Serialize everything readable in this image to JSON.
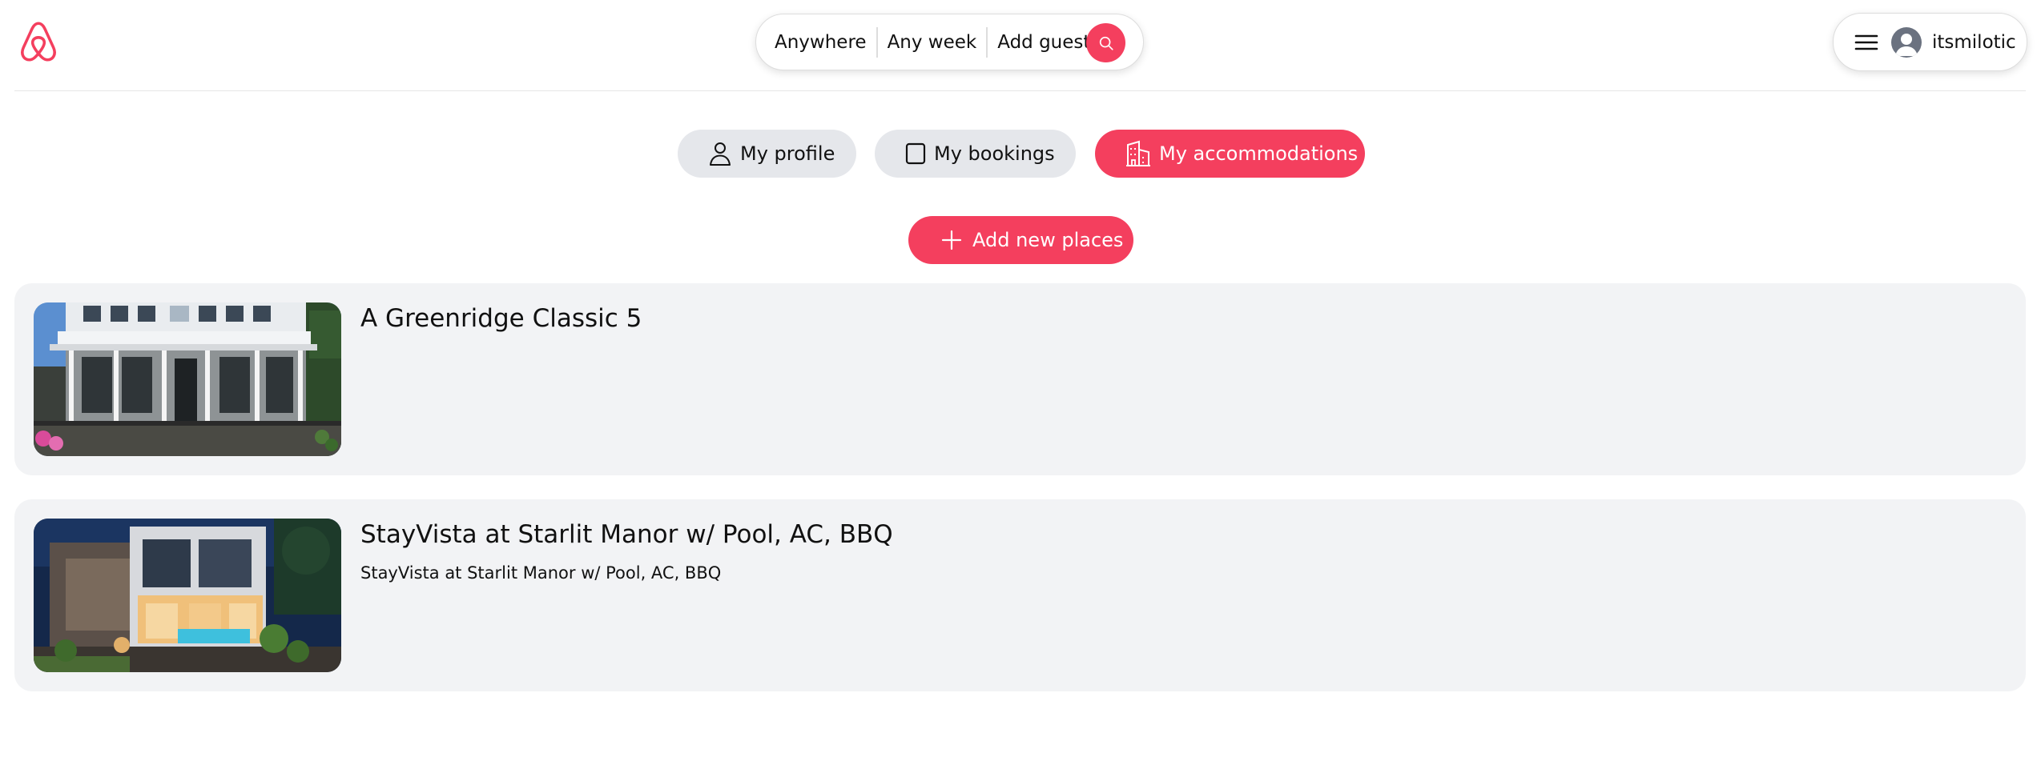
{
  "header": {
    "logo_icon": "airbnb-logo-icon",
    "search": {
      "where": "Anywhere",
      "when": "Any week",
      "guests": "Add guests",
      "button_icon": "search-icon"
    },
    "user_menu": {
      "menu_icon": "hamburger-icon",
      "avatar_icon": "user-avatar-icon",
      "username": "itsmilotic"
    }
  },
  "account_nav": {
    "tabs": [
      {
        "label": "My profile",
        "icon": "user-icon",
        "active": false
      },
      {
        "label": "My bookings",
        "icon": "bookings-icon",
        "active": false
      },
      {
        "label": "My accommodations",
        "icon": "buildings-icon",
        "active": true
      }
    ]
  },
  "add_button": {
    "label": "Add new places",
    "icon": "plus-icon"
  },
  "places": [
    {
      "title": "A Greenridge Classic 5",
      "description": ""
    },
    {
      "title": "StayVista at Starlit Manor w/ Pool, AC, BBQ",
      "description": "StayVista at Starlit Manor w/ Pool, AC, BBQ"
    }
  ],
  "colors": {
    "brand": "#f43f5e",
    "pill_grey": "#e5e7eb",
    "card_bg": "#f2f3f5"
  }
}
